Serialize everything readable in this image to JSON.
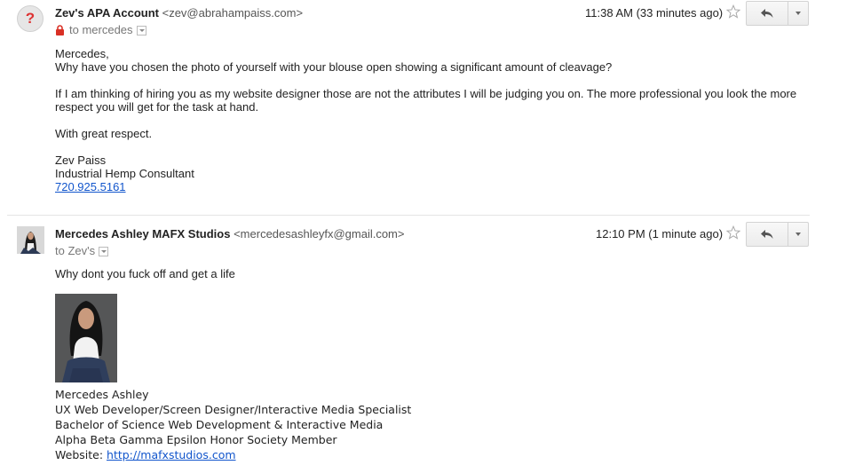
{
  "messages": [
    {
      "sender_name": "Zev's APA Account",
      "sender_email": "<zev@abrahampaiss.com>",
      "recipient": "to mercedes",
      "time": "11:38 AM (33 minutes ago)",
      "avatar_glyph": "?",
      "body": {
        "greeting": "Mercedes,",
        "line1": "Why have you chosen the photo of yourself with your blouse open showing a significant amount of cleavage?",
        "para2_line1": "If I am thinking of hiring you as my website designer those are not the attributes I will be judging you on. The more professional you look the more",
        "para2_line2": "respect you will get for the task at hand.",
        "closing": "With great respect.",
        "sig_name": "Zev Paiss",
        "sig_title": "Industrial Hemp Consultant",
        "sig_phone": "720.925.5161"
      }
    },
    {
      "sender_name": "Mercedes Ashley MAFX Studios",
      "sender_email": "<mercedesashleyfx@gmail.com>",
      "recipient": "to Zev's",
      "time": "12:10 PM (1 minute ago)",
      "body": {
        "line1": "Why dont you fuck off and get a life"
      },
      "signature": {
        "name": "Mercedes Ashley",
        "title": "UX Web Developer/Screen Designer/Interactive Media Specialist",
        "degree": "Bachelor of Science Web Development & Interactive Media",
        "society": "Alpha Beta Gamma Epsilon Honor Society Member",
        "website_label": "Website: ",
        "website_url": "http://mafxstudios.com"
      }
    }
  ],
  "icons": {
    "lock": "lock-icon",
    "star": "star-icon",
    "reply": "reply-arrow-icon",
    "more": "chevron-down-icon"
  },
  "colors": {
    "link": "#1155cc",
    "lock": "#d93025",
    "unknown_avatar": "#dd3333"
  }
}
